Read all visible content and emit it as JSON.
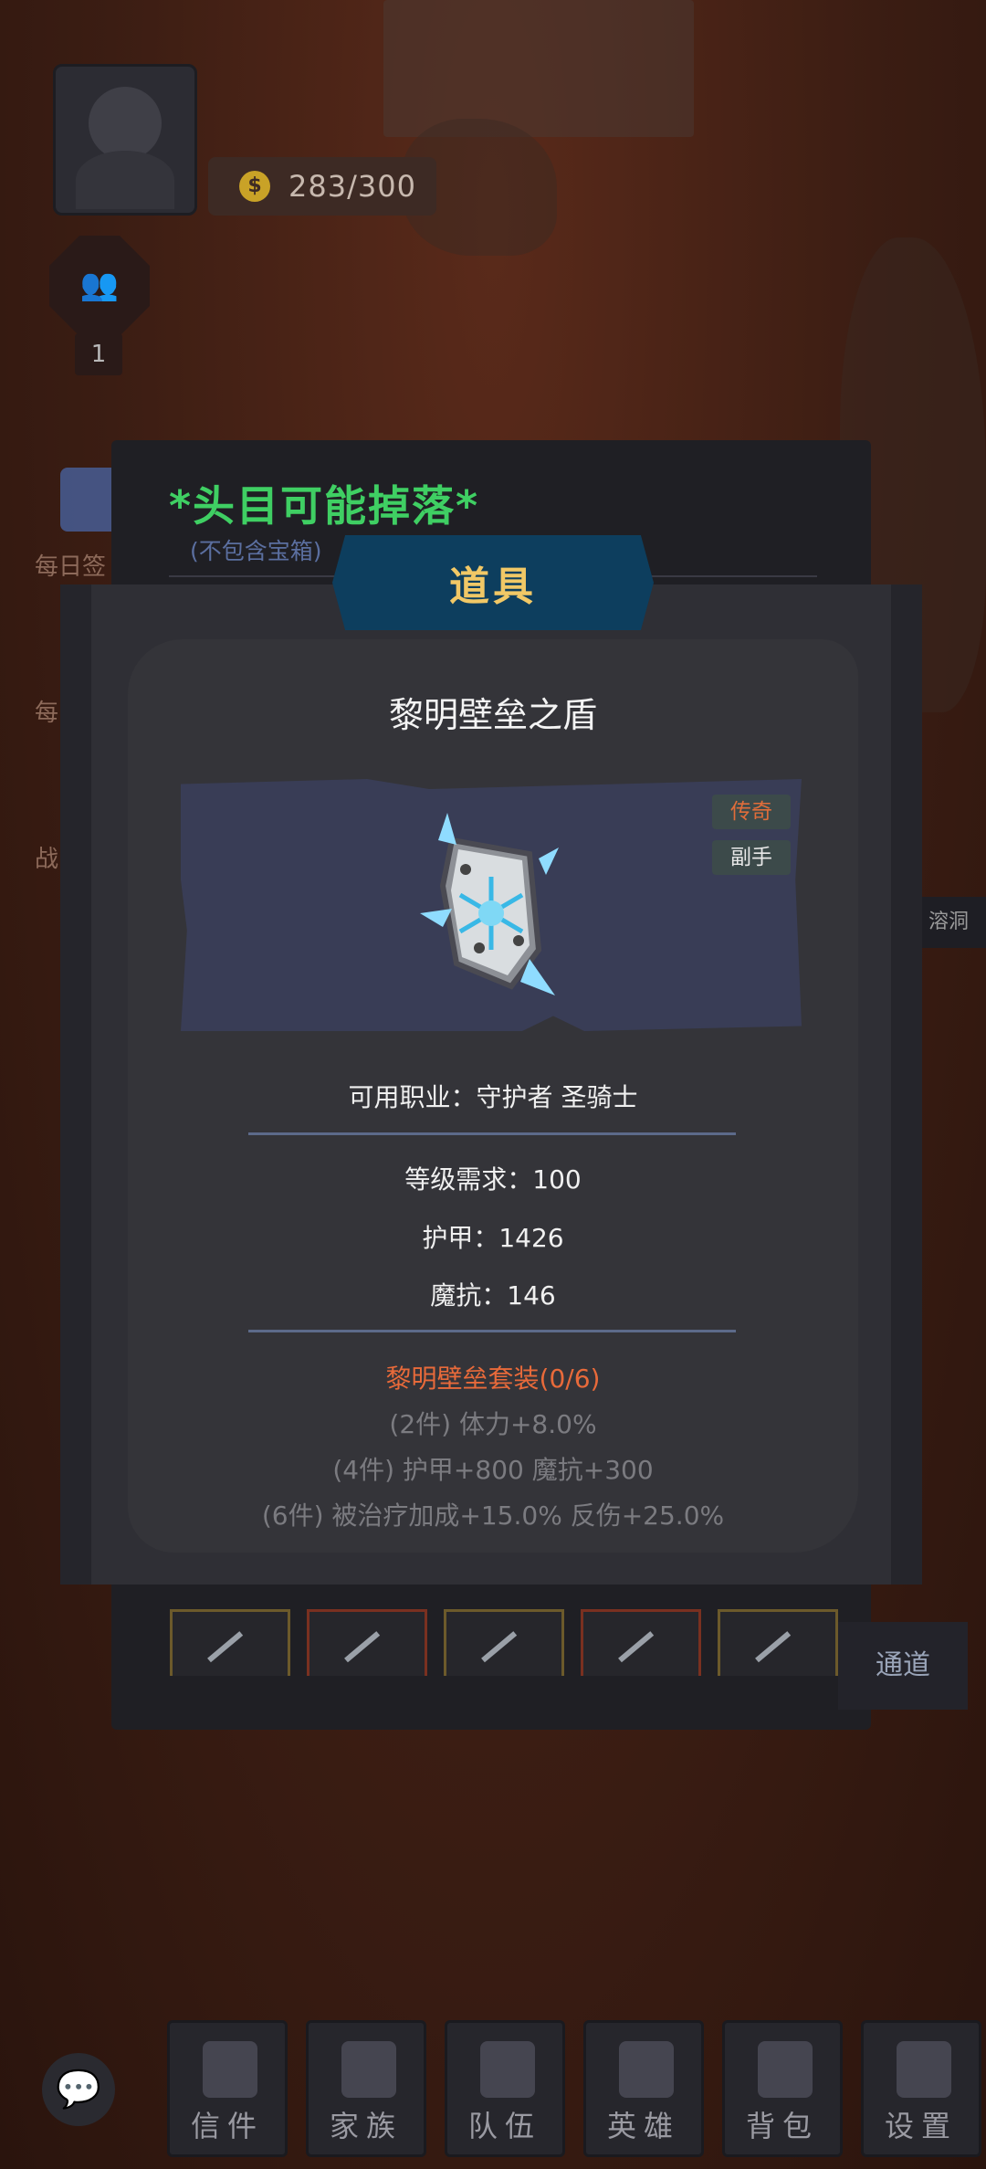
{
  "hud": {
    "currency_value": "283/300",
    "team_count": "1",
    "side_labels": [
      "每日签",
      "每",
      "战"
    ],
    "right_tag": "溶洞"
  },
  "drop_panel": {
    "title": "*头目可能掉落*",
    "subtitle": "(不包含宝箱)",
    "passage_label": "通道"
  },
  "item": {
    "banner_title": "道具",
    "name": "黎明壁垒之盾",
    "rarity_badge": "传奇",
    "slot_badge": "副手",
    "classes": "可用职业：守护者 圣骑士",
    "level_req": "等级需求：100",
    "armor": "护甲：1426",
    "magic_resist": "魔抗：146",
    "set_title": "黎明壁垒套装(0/6)",
    "set_bonus_2": "(2件) 体力+8.0%",
    "set_bonus_4": "(4件) 护甲+800   魔抗+300",
    "set_bonus_6": "(6件) 被治疗加成+15.0%   反伤+25.0%"
  },
  "nav": [
    {
      "label": "信件",
      "icon": "scroll-icon"
    },
    {
      "label": "家族",
      "icon": "shield-banner-icon"
    },
    {
      "label": "队伍",
      "icon": "flag-icon"
    },
    {
      "label": "英雄",
      "icon": "helmet-icon"
    },
    {
      "label": "背包",
      "icon": "bag-icon"
    },
    {
      "label": "设置",
      "icon": "gear-icon"
    }
  ],
  "colors": {
    "drop_title": "#3fcf63",
    "banner_bg": "#0d3e5e",
    "banner_text": "#f1c866",
    "legendary": "#e06d3a",
    "set_title": "#e86a3a"
  }
}
